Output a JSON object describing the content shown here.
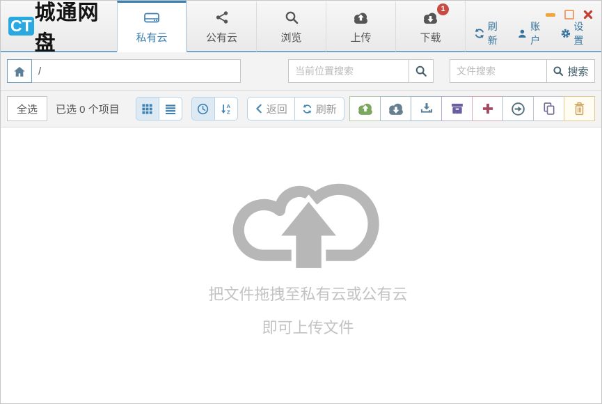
{
  "window": {
    "logo_badge": "CT",
    "logo_text": "城通网盘"
  },
  "tabs": [
    {
      "label": "私有云",
      "icon": "hard-drive-icon",
      "active": true
    },
    {
      "label": "公有云",
      "icon": "share-icon",
      "active": false
    },
    {
      "label": "浏览",
      "icon": "search-icon",
      "active": false
    },
    {
      "label": "上传",
      "icon": "cloud-upload-icon",
      "active": false
    },
    {
      "label": "下载",
      "icon": "cloud-download-icon",
      "active": false,
      "badge": "1"
    }
  ],
  "utility": {
    "refresh_label": "刷新",
    "account_label": "账户",
    "settings_label": "设置"
  },
  "address_bar": {
    "path_value": "/",
    "location_search_placeholder": "当前位置搜索",
    "file_search_placeholder": "文件搜索",
    "search_button_label": "搜索"
  },
  "toolbar": {
    "select_all_label": "全选",
    "selection_status": "已选 0 个项目",
    "back_label": "返回",
    "refresh_label": "刷新"
  },
  "dropzone": {
    "line1": "把文件拖拽至私有云或公有云",
    "line2": "即可上传文件"
  },
  "colors": {
    "accent_blue": "#3c7fb1",
    "badge_red": "#c94a42",
    "upload_green": "#7ca75f",
    "download_slate": "#66808f",
    "install_blue": "#5b7e97",
    "archive_purple": "#6a5ea3",
    "add_maroon": "#a34a60",
    "move_slate": "#53707e",
    "copy_purple": "#6f6b94",
    "trash_tan": "#cfa35f",
    "link_blue": "#36749e",
    "drop_gray": "#b7b7b7"
  }
}
